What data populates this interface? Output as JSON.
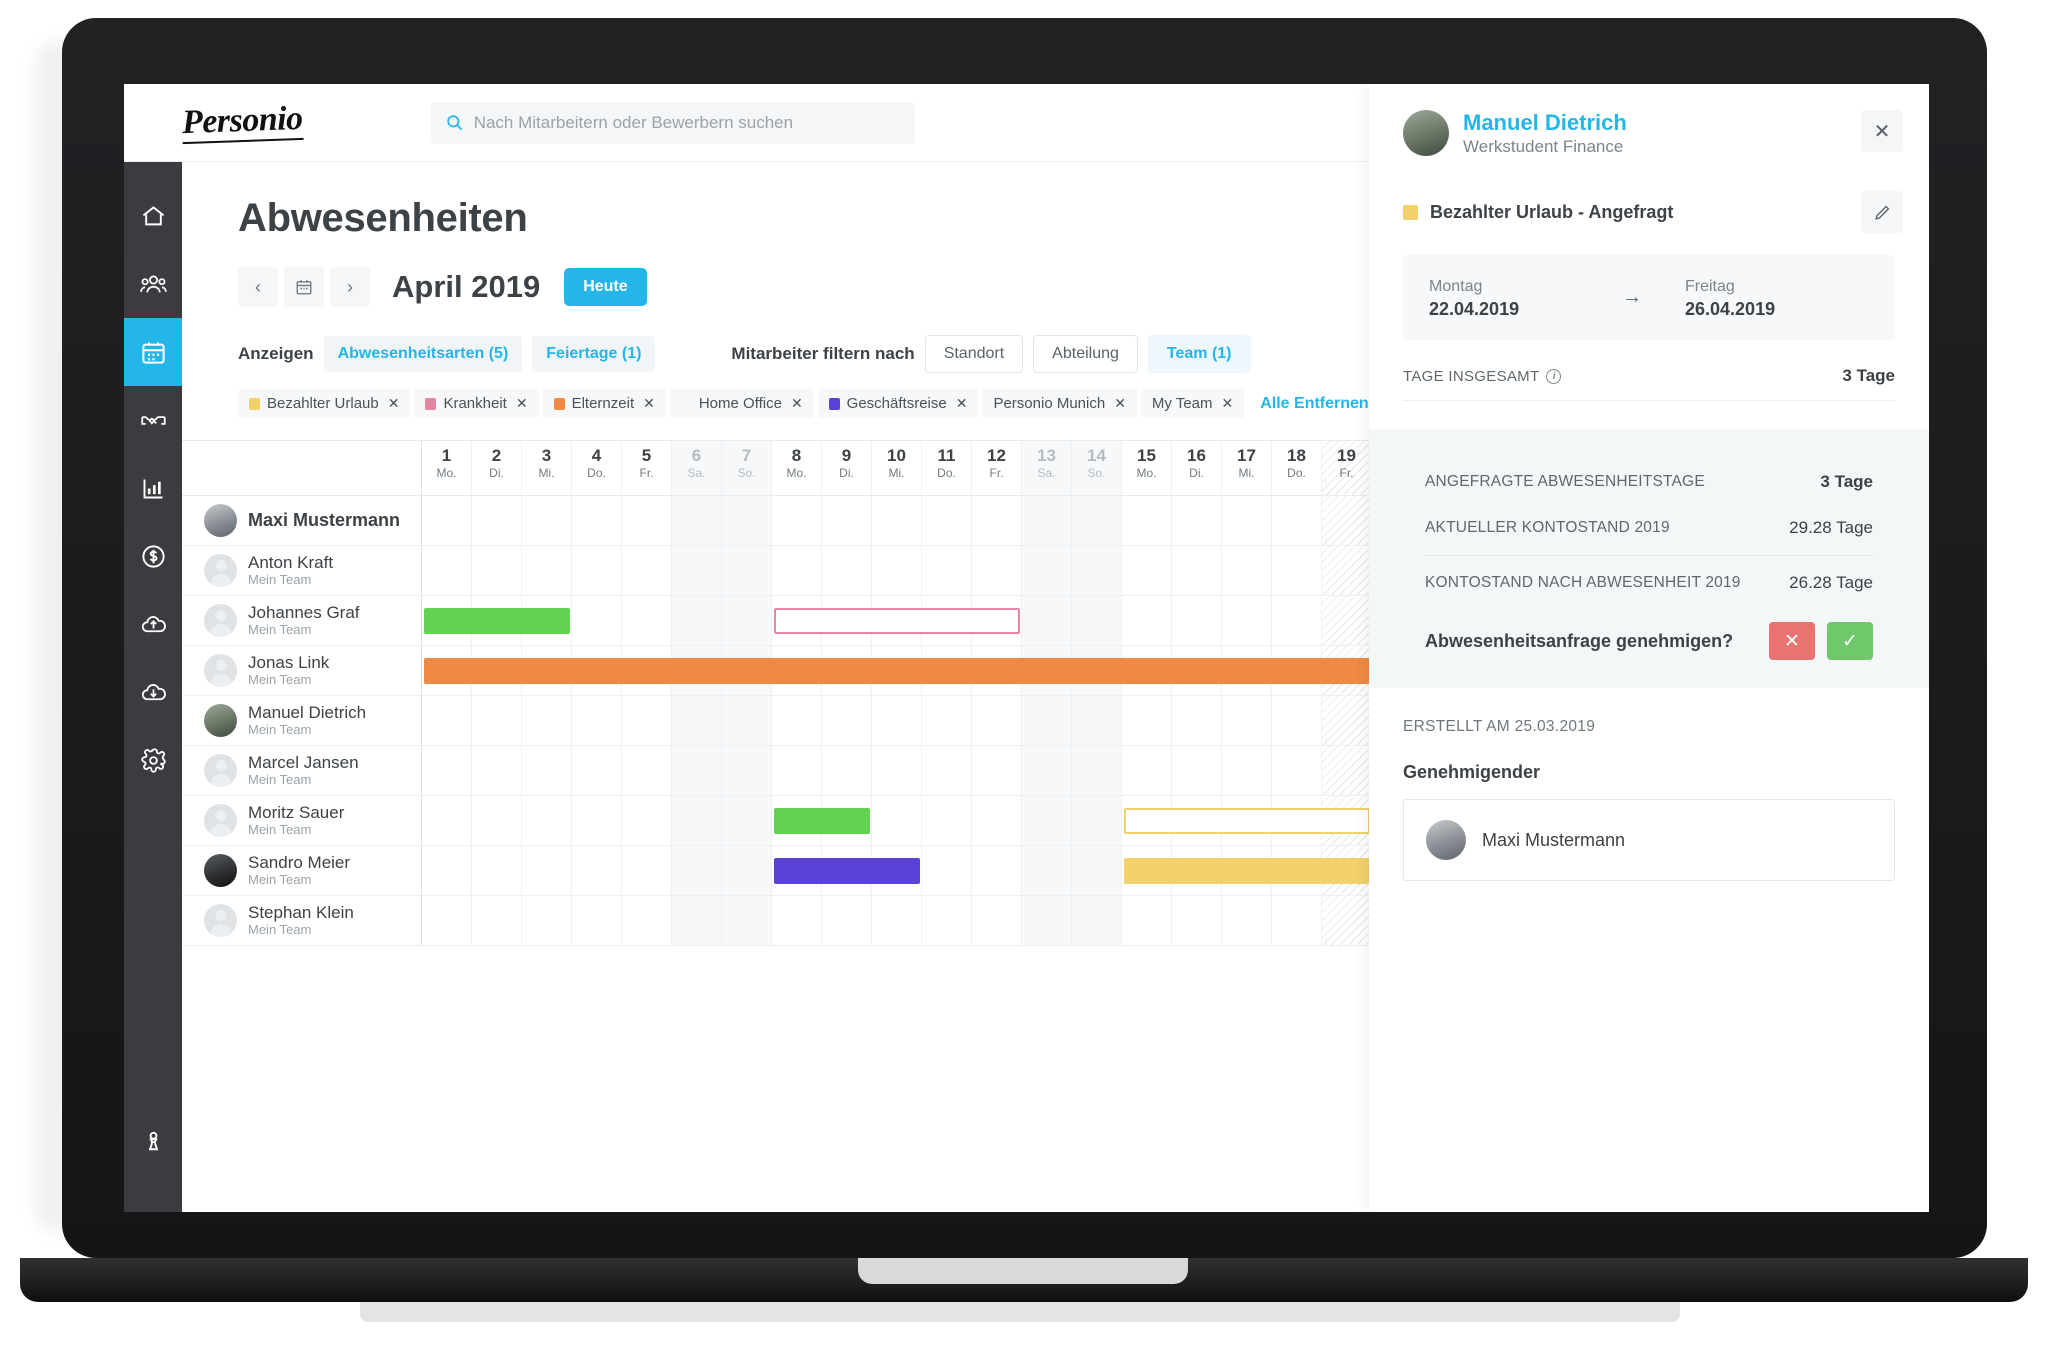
{
  "app": {
    "logo_text": "Personio",
    "search_placeholder": "Nach Mitarbeitern oder Bewerbern suchen",
    "page_title": "Abwesenheiten"
  },
  "sidebar": {
    "items": [
      {
        "name": "home",
        "icon": "home-icon",
        "active": false
      },
      {
        "name": "employees",
        "icon": "people-icon",
        "active": false
      },
      {
        "name": "absences",
        "icon": "calendar-icon",
        "active": true
      },
      {
        "name": "recruiting",
        "icon": "handshake-icon",
        "active": false
      },
      {
        "name": "reports",
        "icon": "bar-chart-icon",
        "active": false
      },
      {
        "name": "payroll",
        "icon": "dollar-circle-icon",
        "active": false
      },
      {
        "name": "upload",
        "icon": "cloud-upload-icon",
        "active": false
      },
      {
        "name": "download",
        "icon": "cloud-download-icon",
        "active": false
      },
      {
        "name": "settings",
        "icon": "gear-icon",
        "active": false
      }
    ],
    "bottom_item": {
      "name": "account",
      "icon": "pawn-person-icon"
    }
  },
  "toolbar": {
    "prev_label": "‹",
    "next_label": "›",
    "calendar_icon": "calendar-picker-icon",
    "month_label": "April 2019",
    "today_label": "Heute"
  },
  "filters": {
    "show_label": "Anzeigen",
    "absence_types_label": "Abwesenheitsarten (5)",
    "holidays_label": "Feiertage (1)",
    "filter_by_label": "Mitarbeiter filtern nach",
    "location_label": "Standort",
    "department_label": "Abteilung",
    "team_label": "Team (1)",
    "clear_all_label": "Alle Entfernen",
    "tags": [
      {
        "label": "Bezahlter Urlaub",
        "color": "#f2d16b",
        "remove": "✕"
      },
      {
        "label": "Krankheit",
        "color": "#e2879f",
        "remove": "✕"
      },
      {
        "label": "Elternzeit",
        "color": "#ef8a44",
        "remove": "✕"
      },
      {
        "label": "Home Office",
        "color": "#63d košt",
        "remove": "✕"
      },
      {
        "label": "Geschäftsreise",
        "color": "#5b42d6",
        "remove": "✕"
      },
      {
        "label": "Personio Munich",
        "color": null,
        "remove": "✕"
      },
      {
        "label": "My Team",
        "color": null,
        "remove": "✕"
      }
    ]
  },
  "calendar": {
    "days": [
      {
        "num": "1",
        "label": "Mo.",
        "weekend": false,
        "holiday": false
      },
      {
        "num": "2",
        "label": "Di.",
        "weekend": false,
        "holiday": false
      },
      {
        "num": "3",
        "label": "Mi.",
        "weekend": false,
        "holiday": false
      },
      {
        "num": "4",
        "label": "Do.",
        "weekend": false,
        "holiday": false
      },
      {
        "num": "5",
        "label": "Fr.",
        "weekend": false,
        "holiday": false
      },
      {
        "num": "6",
        "label": "Sa.",
        "weekend": true,
        "holiday": false
      },
      {
        "num": "7",
        "label": "So.",
        "weekend": true,
        "holiday": false
      },
      {
        "num": "8",
        "label": "Mo.",
        "weekend": false,
        "holiday": false
      },
      {
        "num": "9",
        "label": "Di.",
        "weekend": false,
        "holiday": false
      },
      {
        "num": "10",
        "label": "Mi.",
        "weekend": false,
        "holiday": false
      },
      {
        "num": "11",
        "label": "Do.",
        "weekend": false,
        "holiday": false
      },
      {
        "num": "12",
        "label": "Fr.",
        "weekend": false,
        "holiday": false
      },
      {
        "num": "13",
        "label": "Sa.",
        "weekend": true,
        "holiday": false
      },
      {
        "num": "14",
        "label": "So.",
        "weekend": true,
        "holiday": false
      },
      {
        "num": "15",
        "label": "Mo.",
        "weekend": false,
        "holiday": false
      },
      {
        "num": "16",
        "label": "Di.",
        "weekend": false,
        "holiday": false
      },
      {
        "num": "17",
        "label": "Mi.",
        "weekend": false,
        "holiday": false
      },
      {
        "num": "18",
        "label": "Do.",
        "weekend": false,
        "holiday": false
      },
      {
        "num": "19",
        "label": "Fr.",
        "weekend": false,
        "holiday": true
      }
    ],
    "rows": [
      {
        "name": "Maxi Mustermann",
        "team": "",
        "avatar": "photo-w",
        "highlight": true,
        "bars": []
      },
      {
        "name": "Anton Kraft",
        "team": "Mein Team",
        "avatar": "placeholder",
        "bars": []
      },
      {
        "name": "Johannes Graf",
        "team": "Mein Team",
        "avatar": "placeholder",
        "bars": [
          {
            "start": 1,
            "span": 3,
            "color": "#63d152",
            "style": "solid",
            "type": "Home Office"
          },
          {
            "start": 8,
            "span": 5,
            "color": "#e2879f",
            "style": "outline",
            "type": "Krankheit"
          }
        ]
      },
      {
        "name": "Jonas Link",
        "team": "Mein Team",
        "avatar": "placeholder",
        "bars": [
          {
            "start": 1,
            "span": 19,
            "color": "#ef8a44",
            "style": "solid",
            "type": "Elternzeit"
          }
        ]
      },
      {
        "name": "Manuel Dietrich",
        "team": "Mein Team",
        "avatar": "photo-m",
        "bars": []
      },
      {
        "name": "Marcel Jansen",
        "team": "Mein Team",
        "avatar": "placeholder",
        "bars": []
      },
      {
        "name": "Moritz Sauer",
        "team": "Mein Team",
        "avatar": "placeholder",
        "bars": [
          {
            "start": 8,
            "span": 2,
            "color": "#63d152",
            "style": "solid",
            "type": "Home Office"
          },
          {
            "start": 15,
            "span": 5,
            "color": "#f2d16b",
            "style": "outline",
            "type": "Bezahlter Urlaub"
          }
        ]
      },
      {
        "name": "Sandro Meier",
        "team": "Mein Team",
        "avatar": "photo-d",
        "bars": [
          {
            "start": 8,
            "span": 3,
            "color": "#5b42d6",
            "style": "solid",
            "type": "Geschäftsreise"
          },
          {
            "start": 15,
            "span": 5,
            "color": "#f2d16b",
            "style": "solid",
            "type": "Bezahlter Urlaub"
          }
        ]
      },
      {
        "name": "Stephan Klein",
        "team": "Mein Team",
        "avatar": "placeholder",
        "bars": []
      }
    ]
  },
  "panel": {
    "person_name": "Manuel Dietrich",
    "person_role": "Werkstudent Finance",
    "close_label": "✕",
    "absence_type": "Bezahlter Urlaub - Angefragt",
    "absence_color": "#f2d16b",
    "edit_icon": "pencil-icon",
    "start_day_label": "Montag",
    "start_date": "22.04.2019",
    "arrow": "→",
    "end_day_label": "Freitag",
    "end_date": "26.04.2019",
    "total_label": "TAGE INSGESAMT",
    "total_value": "3 Tage",
    "stats": [
      {
        "label": "ANGEFRAGTE ABWESENHEITSTAGE",
        "value": "3 Tage",
        "bold": true
      },
      {
        "label": "AKTUELLER KONTOSTAND 2019",
        "value": "29.28 Tage",
        "bold": false
      },
      {
        "label": "KONTOSTAND NACH ABWESENHEIT 2019",
        "value": "26.28 Tage",
        "bold": false
      }
    ],
    "approve_question": "Abwesenheitsanfrage genehmigen?",
    "deny_label": "✕",
    "accept_label": "✓",
    "created_label": "ERSTELLT AM 25.03.2019",
    "approver_title": "Genehmigender",
    "approver_name": "Maxi Mustermann"
  }
}
